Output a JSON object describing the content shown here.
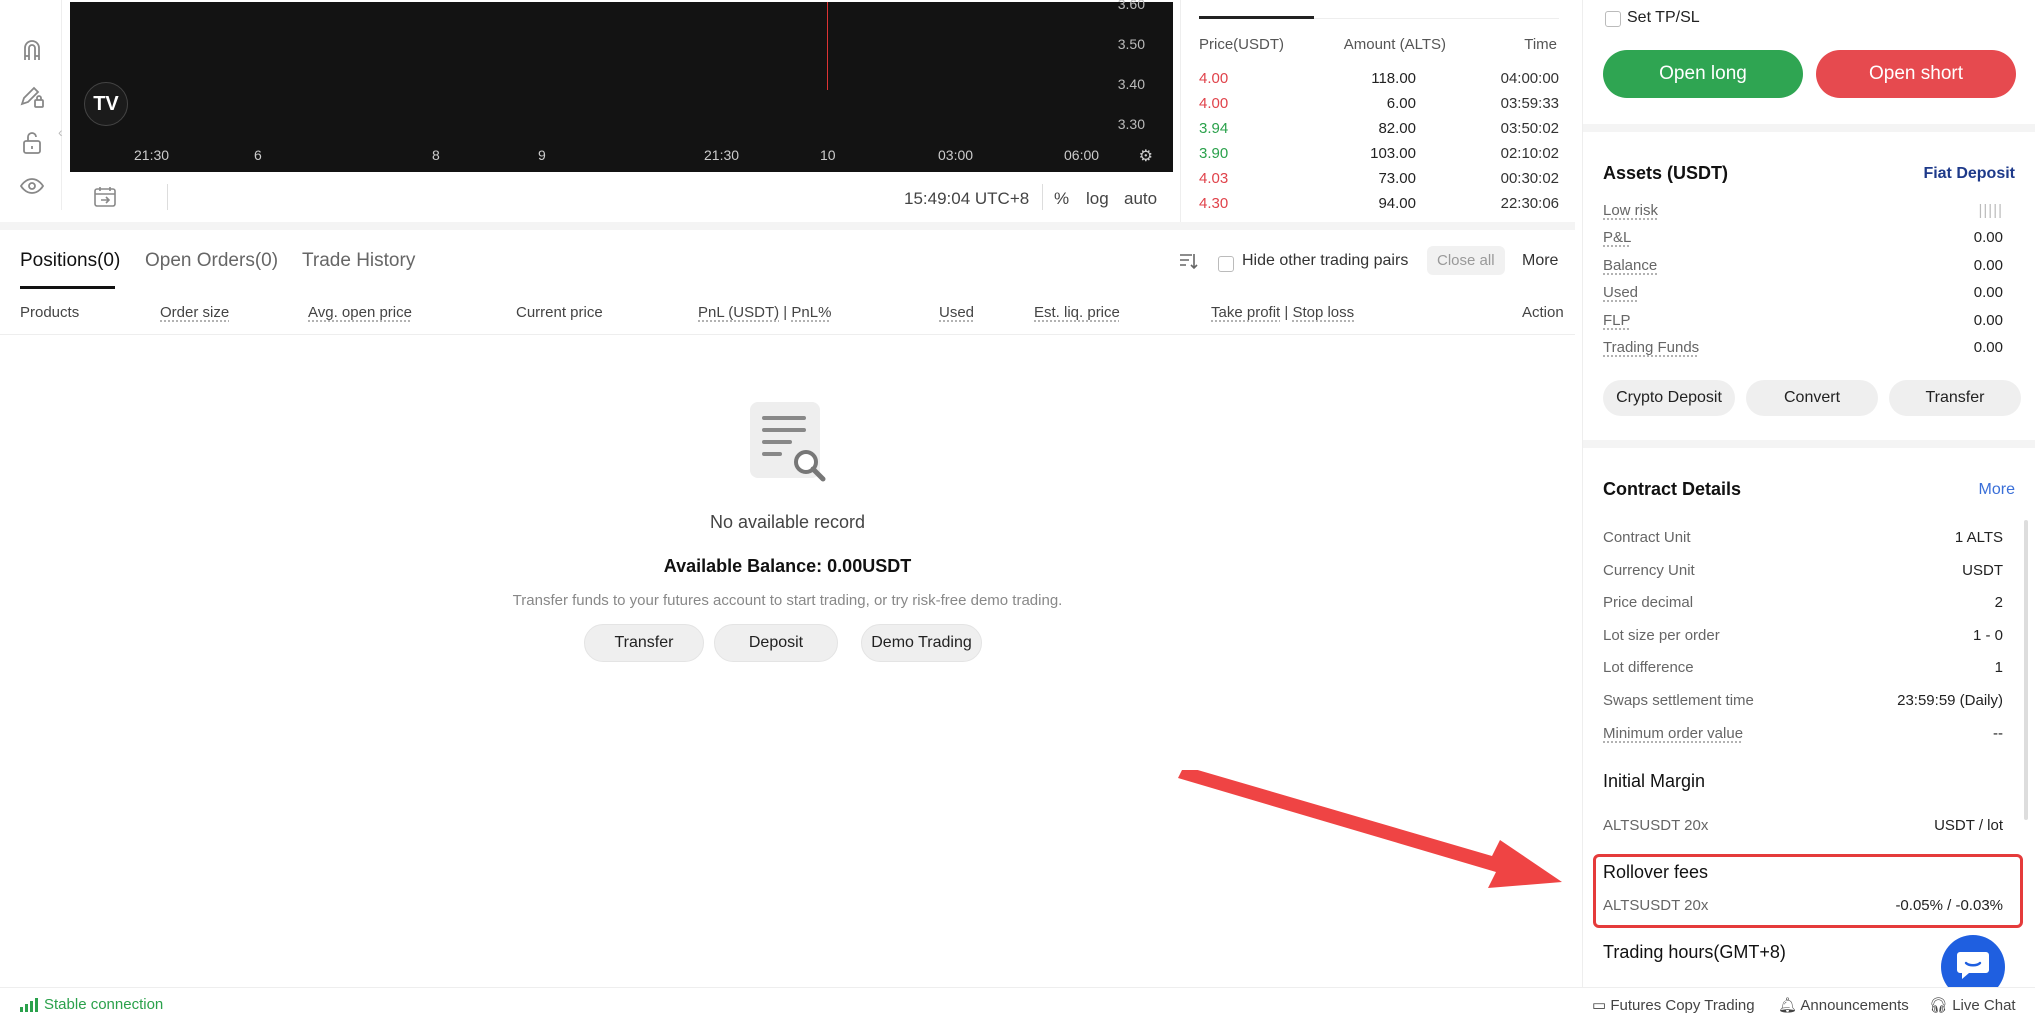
{
  "chart": {
    "y_ticks": [
      "3.60",
      "3.50",
      "3.40",
      "3.30"
    ],
    "x_ticks": [
      "21:30",
      "6",
      "8",
      "9",
      "21:30",
      "10",
      "03:00",
      "06:00"
    ],
    "logo": "TV",
    "timezone": "15:49:04 UTC+8",
    "options": [
      "%",
      "log",
      "auto"
    ]
  },
  "trades": {
    "headers": {
      "price": "Price(USDT)",
      "amount": "Amount (ALTS)",
      "time": "Time"
    },
    "rows": [
      {
        "price": "4.00",
        "amount": "118.00",
        "time": "04:00:00",
        "side": "sell"
      },
      {
        "price": "4.00",
        "amount": "6.00",
        "time": "03:59:33",
        "side": "sell"
      },
      {
        "price": "3.94",
        "amount": "82.00",
        "time": "03:50:02",
        "side": "buy"
      },
      {
        "price": "3.90",
        "amount": "103.00",
        "time": "02:10:02",
        "side": "buy"
      },
      {
        "price": "4.03",
        "amount": "73.00",
        "time": "00:30:02",
        "side": "sell"
      },
      {
        "price": "4.30",
        "amount": "94.00",
        "time": "22:30:06",
        "side": "sell"
      }
    ]
  },
  "positions": {
    "tabs": [
      "Positions(0)",
      "Open Orders(0)",
      "Trade History"
    ],
    "hide_pairs": "Hide other trading pairs",
    "close_all": "Close all",
    "more": "More",
    "columns": {
      "products": "Products",
      "order_size": "Order size",
      "avg_open": "Avg. open price",
      "current": "Current price",
      "pnl": "PnL (USDT)",
      "pnl_sep": "|",
      "pnl_pct": "PnL%",
      "used": "Used",
      "liq": "Est. liq. price",
      "tp": "Take profit",
      "tp_sep": "|",
      "sl": "Stop loss",
      "action": "Action"
    },
    "empty": {
      "message": "No available record",
      "balance": "Available Balance: 0.00USDT",
      "description": "Transfer funds to your futures account to start trading, or try risk-free demo trading.",
      "buttons": [
        "Transfer",
        "Deposit",
        "Demo Trading"
      ]
    }
  },
  "order": {
    "tpsl": "Set TP/SL",
    "open_long": "Open long",
    "open_short": "Open short",
    "colors": {
      "long": "#2fa552",
      "short": "#e64a4f"
    }
  },
  "assets": {
    "title": "Assets (USDT)",
    "link": "Fiat Deposit",
    "rows": [
      {
        "k": "Low risk",
        "v": "|||||"
      },
      {
        "k": "P&L",
        "v": "0.00"
      },
      {
        "k": "Balance",
        "v": "0.00"
      },
      {
        "k": "Used",
        "v": "0.00"
      },
      {
        "k": "FLP",
        "v": "0.00"
      },
      {
        "k": "Trading Funds",
        "v": "0.00"
      }
    ],
    "buttons": [
      "Crypto Deposit",
      "Convert",
      "Transfer"
    ]
  },
  "contract": {
    "title": "Contract Details",
    "more": "More",
    "rows": [
      {
        "k": "Contract Unit",
        "v": "1 ALTS"
      },
      {
        "k": "Currency Unit",
        "v": "USDT"
      },
      {
        "k": "Price decimal",
        "v": "2"
      },
      {
        "k": "Lot size per order",
        "v": "1 - 0"
      },
      {
        "k": "Lot difference",
        "v": "1"
      },
      {
        "k": "Swaps settlement time",
        "v": "23:59:59 (Daily)"
      },
      {
        "k": "Minimum order value",
        "v": "--"
      }
    ],
    "initial_margin": {
      "title": "Initial Margin",
      "k": "ALTSUSDT 20x",
      "v": "USDT / lot"
    },
    "rollover": {
      "title": "Rollover fees",
      "k": "ALTSUSDT 20x",
      "v": "-0.05% / -0.03%"
    },
    "trading_hours": "Trading hours(GMT+8)"
  },
  "footer": {
    "connection": "Stable connection",
    "copy_trading": "Futures Copy Trading",
    "announcements": "Announcements",
    "live_chat": "Live Chat"
  }
}
